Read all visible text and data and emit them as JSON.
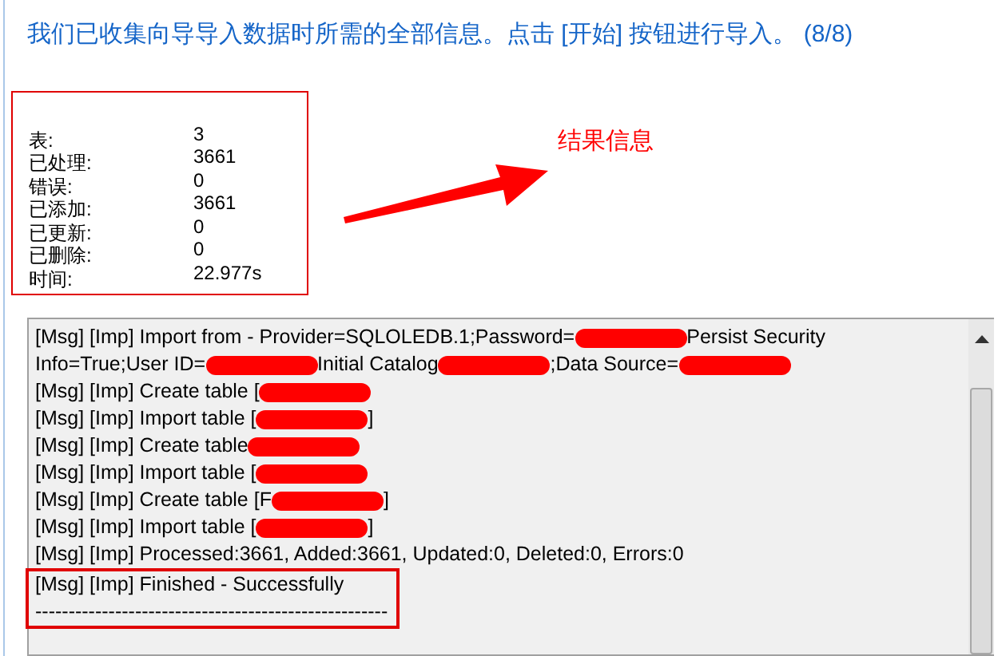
{
  "heading": "我们已收集向导导入数据时所需的全部信息。点击 [开始] 按钮进行导入。 (8/8)",
  "stats": [
    {
      "label": "表:",
      "value": "3"
    },
    {
      "label": "已处理:",
      "value": "3661"
    },
    {
      "label": "错误:",
      "value": "0"
    },
    {
      "label": "已添加:",
      "value": "3661"
    },
    {
      "label": "已更新:",
      "value": "0"
    },
    {
      "label": "已删除:",
      "value": "0"
    },
    {
      "label": "时间:",
      "value": "22.977s"
    }
  ],
  "annotation": "结果信息",
  "log": [
    {
      "boxed": false,
      "parts": [
        {
          "kind": "text",
          "text": "[Msg] [Imp] Import from - Provider=SQLOLEDB.1;Password="
        },
        {
          "kind": "redaction"
        },
        {
          "kind": "text",
          "text": "Persist Security"
        }
      ]
    },
    {
      "boxed": false,
      "parts": [
        {
          "kind": "text",
          "text": "Info=True;User ID="
        },
        {
          "kind": "redaction"
        },
        {
          "kind": "text",
          "text": "Initial Catalog"
        },
        {
          "kind": "redaction"
        },
        {
          "kind": "text",
          "text": ";Data Source="
        },
        {
          "kind": "redaction"
        }
      ]
    },
    {
      "boxed": false,
      "parts": [
        {
          "kind": "text",
          "text": "[Msg] [Imp] Create table ["
        },
        {
          "kind": "redaction"
        }
      ]
    },
    {
      "boxed": false,
      "parts": [
        {
          "kind": "text",
          "text": "[Msg] [Imp] Import table ["
        },
        {
          "kind": "redaction"
        },
        {
          "kind": "text",
          "text": "]"
        }
      ]
    },
    {
      "boxed": false,
      "parts": [
        {
          "kind": "text",
          "text": "[Msg] [Imp] Create table"
        },
        {
          "kind": "redaction"
        }
      ]
    },
    {
      "boxed": false,
      "parts": [
        {
          "kind": "text",
          "text": "[Msg] [Imp] Import table ["
        },
        {
          "kind": "redaction"
        }
      ]
    },
    {
      "boxed": false,
      "parts": [
        {
          "kind": "text",
          "text": "[Msg] [Imp] Create table [F"
        },
        {
          "kind": "redaction"
        },
        {
          "kind": "text",
          "text": "]"
        }
      ]
    },
    {
      "boxed": false,
      "parts": [
        {
          "kind": "text",
          "text": "[Msg] [Imp] Import table ["
        },
        {
          "kind": "redaction"
        },
        {
          "kind": "text",
          "text": "]"
        }
      ]
    },
    {
      "boxed": false,
      "parts": [
        {
          "kind": "text",
          "text": "[Msg] [Imp] Processed:3661, Added:3661, Updated:0, Deleted:0, Errors:0"
        }
      ]
    },
    {
      "boxed": true,
      "parts": [
        {
          "kind": "text",
          "text": "[Msg] [Imp] Finished - Successfully"
        }
      ]
    },
    {
      "boxed": true,
      "parts": [
        {
          "kind": "text",
          "text": "-----------------------------------------------------"
        }
      ]
    }
  ]
}
